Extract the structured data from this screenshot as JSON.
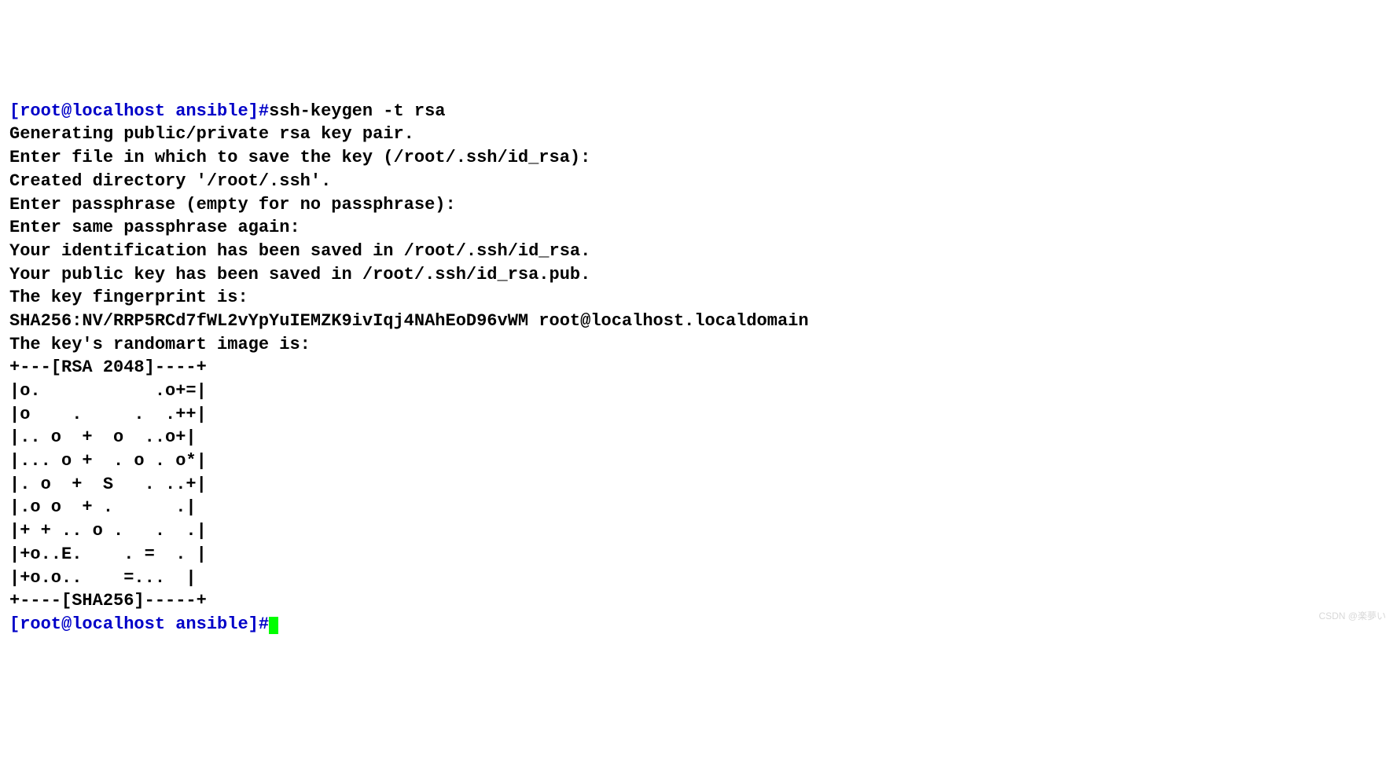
{
  "prompt1_prefix": "[root@localhost ansible]#",
  "command1": "ssh-keygen -t rsa",
  "output": {
    "l00": "Generating public/private rsa key pair.",
    "l01": "Enter file in which to save the key (/root/.ssh/id_rsa): ",
    "l02": "Created directory '/root/.ssh'.",
    "l03": "Enter passphrase (empty for no passphrase): ",
    "l04": "Enter same passphrase again: ",
    "l05": "Your identification has been saved in /root/.ssh/id_rsa.",
    "l06": "Your public key has been saved in /root/.ssh/id_rsa.pub.",
    "l07": "The key fingerprint is:",
    "l08": "SHA256:NV/RRP5RCd7fWL2vYpYuIEMZK9ivIqj4NAhEoD96vWM root@localhost.localdomain",
    "l09": "The key's randomart image is:",
    "l10": "+---[RSA 2048]----+",
    "l11": "|o.           .o+=|",
    "l12": "|o    .     .  .++|",
    "l13": "|.. o  +  o  ..o+|",
    "l14": "|... o +  . o . o*|",
    "l15": "|. o  +  S   . ..+|",
    "l16": "|.o o  + .      .|",
    "l17": "|+ + .. o .   .  .|",
    "l18": "|+o..E.    . =  . |",
    "l19": "|+o.o..    =...  |",
    "l20": "+----[SHA256]-----+"
  },
  "prompt2_prefix": "[root@localhost ansible]#",
  "watermark": "CSDN @楽夢い"
}
